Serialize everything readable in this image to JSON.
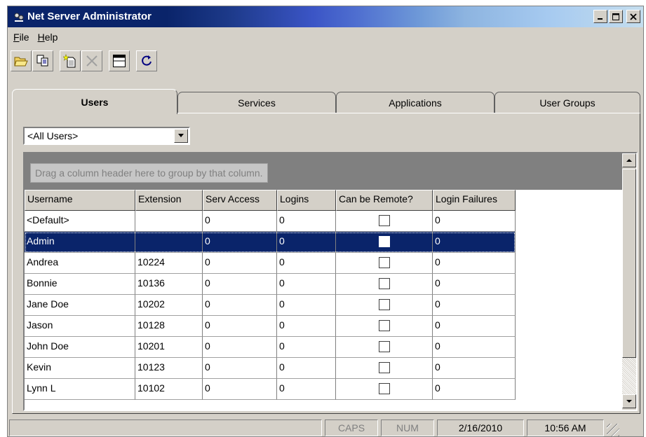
{
  "window": {
    "title": "Net Server Administrator"
  },
  "menu": [
    {
      "label": "File"
    },
    {
      "label": "Help"
    }
  ],
  "toolbar": [
    {
      "icon": "open-folder-icon"
    },
    {
      "icon": "copy-icon"
    },
    {
      "icon": "new-document-icon"
    },
    {
      "icon": "delete-icon"
    },
    {
      "icon": "window-icon"
    },
    {
      "icon": "refresh-icon"
    }
  ],
  "tabs": [
    {
      "label": "Users",
      "active": true
    },
    {
      "label": "Services"
    },
    {
      "label": "Applications"
    },
    {
      "label": "User Groups"
    }
  ],
  "filter": {
    "selected": "<All Users>"
  },
  "grid": {
    "group_hint": "Drag a column header here to group by that column.",
    "columns": [
      "Username",
      "Extension",
      "Serv Access",
      "Logins",
      "Can be Remote?",
      "Login Failures"
    ],
    "rows": [
      {
        "username": "<Default>",
        "extension": "",
        "serv_access": "0",
        "logins": "0",
        "remote": false,
        "failures": "0"
      },
      {
        "username": "Admin",
        "extension": "",
        "serv_access": "0",
        "logins": "0",
        "remote": false,
        "failures": "0",
        "selected": true
      },
      {
        "username": "Andrea",
        "extension": "10224",
        "serv_access": "0",
        "logins": "0",
        "remote": false,
        "failures": "0"
      },
      {
        "username": "Bonnie",
        "extension": "10136",
        "serv_access": "0",
        "logins": "0",
        "remote": false,
        "failures": "0"
      },
      {
        "username": "Jane Doe",
        "extension": "10202",
        "serv_access": "0",
        "logins": "0",
        "remote": false,
        "failures": "0"
      },
      {
        "username": "Jason",
        "extension": "10128",
        "serv_access": "0",
        "logins": "0",
        "remote": false,
        "failures": "0"
      },
      {
        "username": "John Doe",
        "extension": "10201",
        "serv_access": "0",
        "logins": "0",
        "remote": false,
        "failures": "0"
      },
      {
        "username": "Kevin",
        "extension": "10123",
        "serv_access": "0",
        "logins": "0",
        "remote": false,
        "failures": "0"
      },
      {
        "username": "Lynn L",
        "extension": "10102",
        "serv_access": "0",
        "logins": "0",
        "remote": false,
        "failures": "0"
      }
    ]
  },
  "status": {
    "caps": "CAPS",
    "num": "NUM",
    "date": "2/16/2010",
    "time": "10:56 AM"
  },
  "colors": {
    "title_active": "#0a246a",
    "selection": "#0a246a",
    "face": "#d4d0c8"
  }
}
